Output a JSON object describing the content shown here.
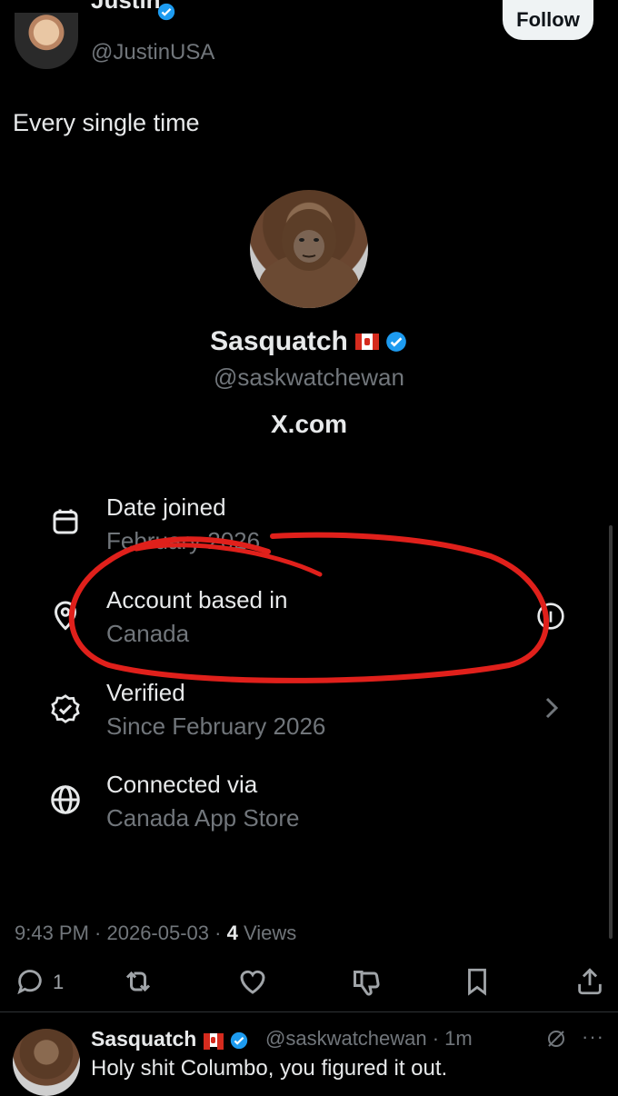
{
  "author": {
    "name": "Justin",
    "handle": "@JustinUSA",
    "follow_label": "Follow"
  },
  "post": {
    "text": "Every single time",
    "timestamp": "9:43 PM · 2026-05-03 · ",
    "views_count": "4",
    "views_label": " Views"
  },
  "card": {
    "name": "Sasquatch",
    "handle": "@saskwatchewan",
    "site": "X.com",
    "rows": [
      {
        "icon": "calendar-icon",
        "title": "Date joined",
        "sub": "February 2026"
      },
      {
        "icon": "location-icon",
        "title": "Account based in",
        "sub": "Canada"
      },
      {
        "icon": "verified-badge-icon",
        "title": "Verified",
        "sub": "Since February 2026"
      },
      {
        "icon": "globe-icon",
        "title": "Connected via",
        "sub": "Canada App Store"
      }
    ]
  },
  "actions": {
    "reply_count": "1"
  },
  "reply": {
    "name": "Sasquatch",
    "handle": "@saskwatchewan · 1m",
    "text": "Holy shit Columbo, you figured it out."
  },
  "colors": {
    "background": "#000000",
    "text": "#e7e9ea",
    "muted": "#71767b",
    "verified": "#1d9bf0",
    "annotation": "#e0201b"
  }
}
